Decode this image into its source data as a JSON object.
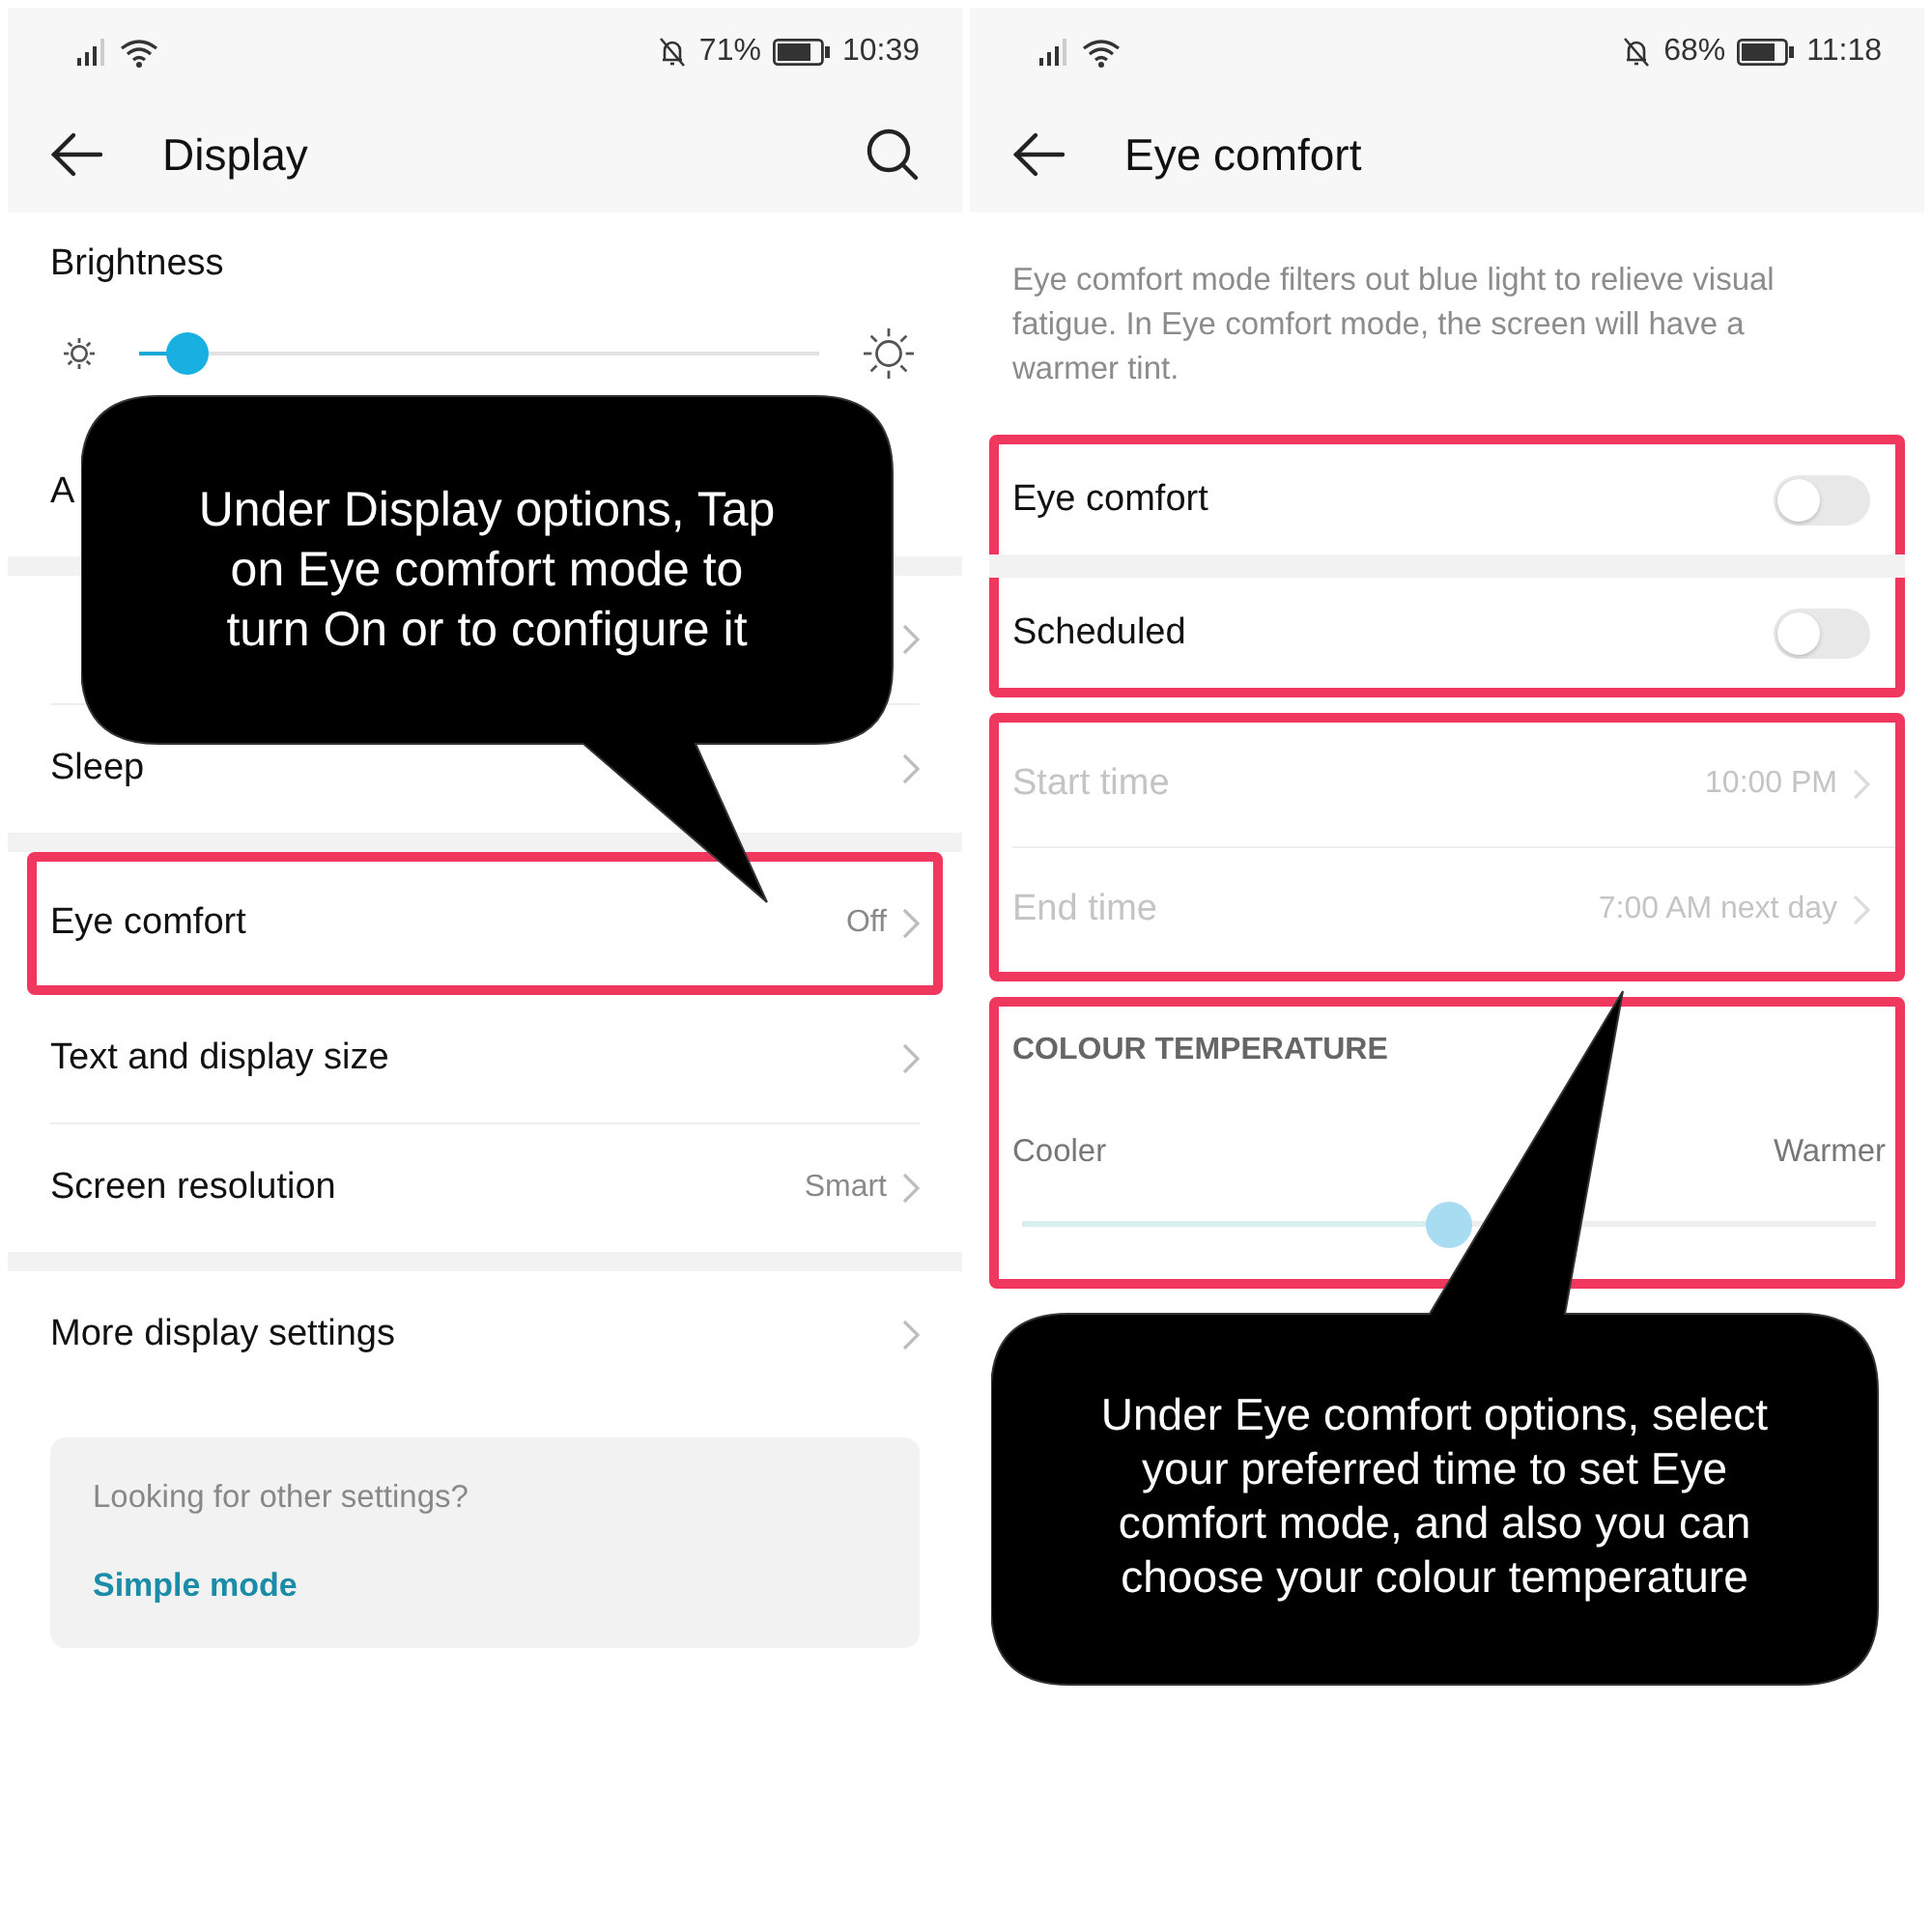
{
  "display_screen": {
    "status_bar": {
      "battery": "71%",
      "time": "10:39"
    },
    "app_bar": {
      "title": "Display"
    },
    "brightness": {
      "label": "Brightness",
      "level": 0.07
    },
    "sections": [
      {
        "rows": [
          {
            "label": "A",
            "chevron": false,
            "highlighted": false
          }
        ]
      },
      {
        "rows": [
          {
            "chevron": true,
            "highlighted": false
          },
          {
            "label": "Sleep",
            "chevron": true,
            "highlighted": false
          }
        ]
      },
      {
        "rows": [
          {
            "label": "Eye comfort",
            "value": "Off",
            "chevron": true,
            "highlighted": true
          },
          {
            "label": "Text and display size",
            "chevron": true,
            "highlighted": false
          },
          {
            "label": "Screen resolution",
            "value": "Smart",
            "chevron": true,
            "highlighted": false
          }
        ]
      },
      {
        "rows": [
          {
            "label": "More display settings",
            "chevron": true,
            "highlighted": false
          }
        ]
      }
    ],
    "card": {
      "prompt": "Looking for other settings?",
      "link": "Simple mode"
    }
  },
  "eye_comfort_screen": {
    "status_bar": {
      "battery": "68%",
      "time": "11:18"
    },
    "app_bar": {
      "title": "Eye comfort"
    },
    "description": "Eye comfort mode filters out blue light to relieve visual fatigue. In Eye comfort mode, the screen will have a warmer tint.",
    "groups": [
      {
        "kind": "rows",
        "highlighted": true,
        "separated": true,
        "rows": [
          {
            "kind": "toggle",
            "label": "Eye comfort",
            "on": false
          },
          {
            "kind": "toggle",
            "label": "Scheduled",
            "on": false
          }
        ]
      },
      {
        "kind": "rows",
        "highlighted": true,
        "separated": false,
        "rows": [
          {
            "kind": "link",
            "label": "Start time",
            "value": "10:00 PM",
            "disabled": true
          },
          {
            "kind": "link",
            "label": "End time",
            "value": "7:00 AM next day",
            "disabled": true
          }
        ]
      },
      {
        "kind": "temperature",
        "highlighted": true,
        "heading": "COLOUR TEMPERATURE",
        "min_label": "Cooler",
        "max_label": "Warmer",
        "level": 0.5
      }
    ]
  },
  "callouts": [
    {
      "text": "Under Display options, Tap on Eye comfort mode to turn On or to configure it"
    },
    {
      "text": "Under Eye comfort options, select your preferred time to set Eye comfort mode, and also you can choose your colour temperature"
    }
  ]
}
